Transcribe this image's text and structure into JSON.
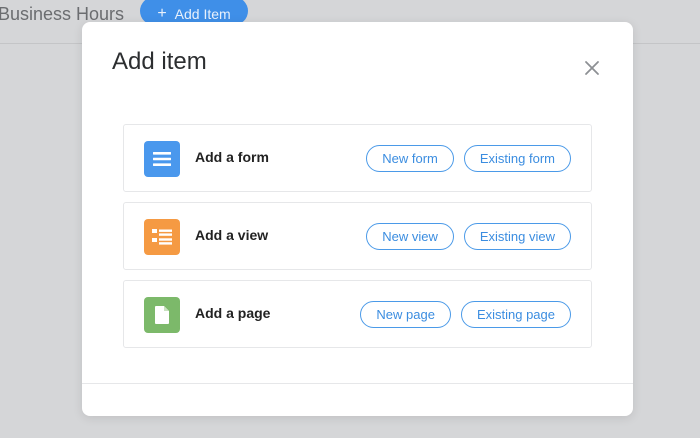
{
  "background": {
    "title": "Business Hours",
    "add_button": {
      "icon": "plus-icon",
      "label": "Add Item"
    }
  },
  "modal": {
    "title": "Add item",
    "close_icon": "close-icon",
    "rows": [
      {
        "label": "Add a form",
        "icon": "form-icon",
        "color": "#4a98ed",
        "primary": "New form",
        "secondary": "Existing form"
      },
      {
        "label": "Add a view",
        "icon": "view-icon",
        "color": "#f59a43",
        "primary": "New view",
        "secondary": "Existing view"
      },
      {
        "label": "Add a page",
        "icon": "page-icon",
        "color": "#7cb96a",
        "primary": "New page",
        "secondary": "Existing page"
      }
    ]
  },
  "colors": {
    "accent": "#3f8fe8",
    "backdrop": "#d5d6d8"
  }
}
